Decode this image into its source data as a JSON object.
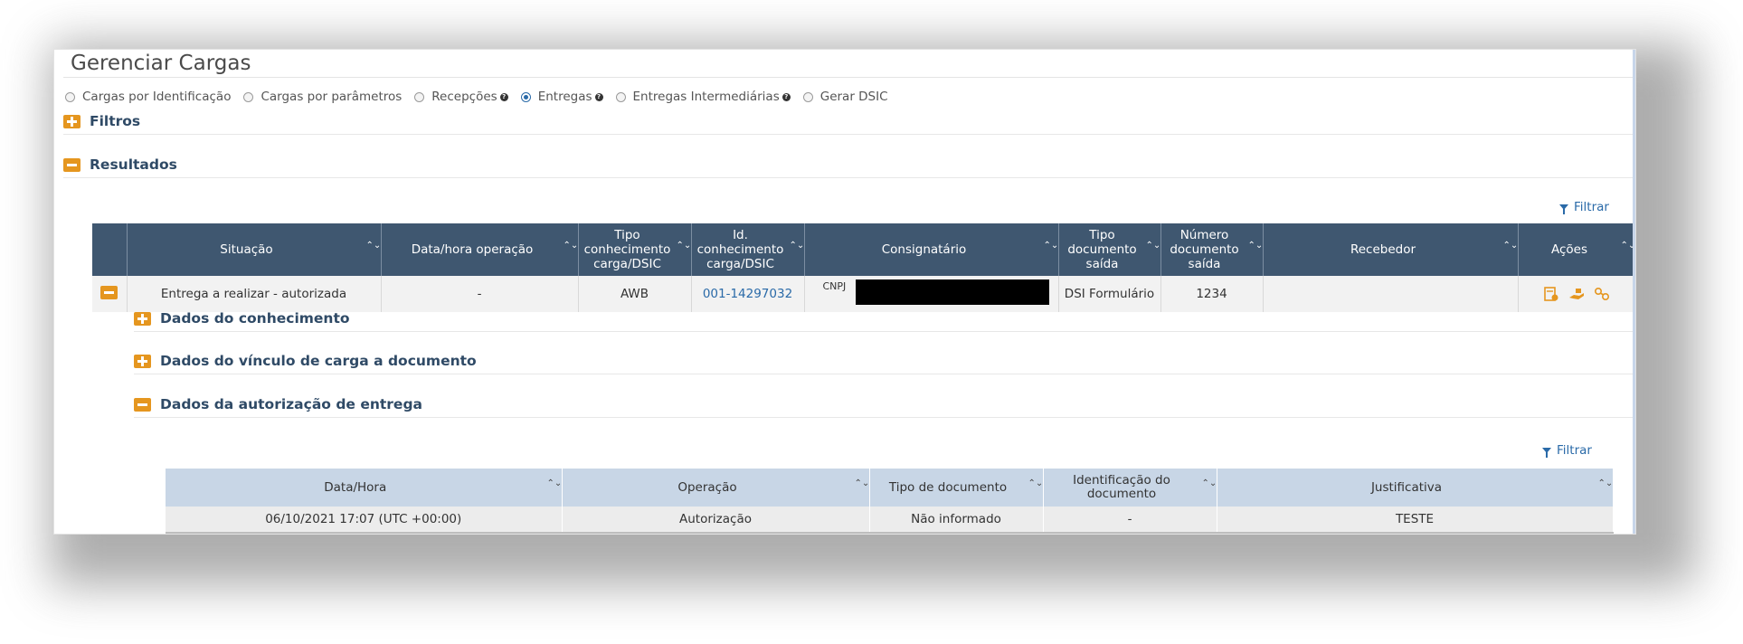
{
  "page": {
    "title": "Gerenciar Cargas"
  },
  "radio_options": [
    {
      "label": "Cargas por Identificação",
      "checked": false,
      "help": false
    },
    {
      "label": "Cargas por parâmetros",
      "checked": false,
      "help": false
    },
    {
      "label": "Recepções",
      "checked": false,
      "help": true
    },
    {
      "label": "Entregas",
      "checked": true,
      "help": true
    },
    {
      "label": "Entregas Intermediárias",
      "checked": false,
      "help": true
    },
    {
      "label": "Gerar DSIC",
      "checked": false,
      "help": false
    }
  ],
  "help_glyph": "?",
  "sections": {
    "filtros": "Filtros",
    "resultados": "Resultados",
    "dados_conhecimento": "Dados do conhecimento",
    "dados_vinculo": "Dados do vínculo de carga a documento",
    "dados_autorizacao": "Dados da autorização de entrega"
  },
  "filtrar_label": "Filtrar",
  "sort_glyph": "⌃⌄",
  "results_table": {
    "columns": [
      "Situação",
      "Data/hora operação",
      "Tipo conhecimento carga/DSIC",
      "Id. conhecimento carga/DSIC",
      "Consignatário",
      "Tipo documento saída",
      "Número documento saída",
      "Recebedor",
      "Ações"
    ],
    "row": {
      "situacao": "Entrega a realizar - autorizada",
      "data_hora": "-",
      "tipo_conhecimento": "AWB",
      "id_conhecimento": "001-14297032",
      "consignatario_label": "CNPJ",
      "tipo_documento": "DSI Formulário",
      "numero_documento": "1234",
      "recebedor": ""
    }
  },
  "action_icons": [
    "document-check-icon",
    "hand-deliver-icon",
    "link-icon"
  ],
  "authorization_table": {
    "columns": [
      "Data/Hora",
      "Operação",
      "Tipo de documento",
      "Identificação do documento",
      "Justificativa"
    ],
    "row": {
      "data_hora": "06/10/2021 17:07 (UTC +00:00)",
      "operacao": "Autorização",
      "tipo_documento": "Não informado",
      "identificacao": "-",
      "justificativa": "TESTE"
    }
  },
  "colors": {
    "header_dark": "#3f5770",
    "accent_orange": "#e5961f",
    "link_blue": "#2a6aa8",
    "sub_header": "#c8d6e6"
  }
}
